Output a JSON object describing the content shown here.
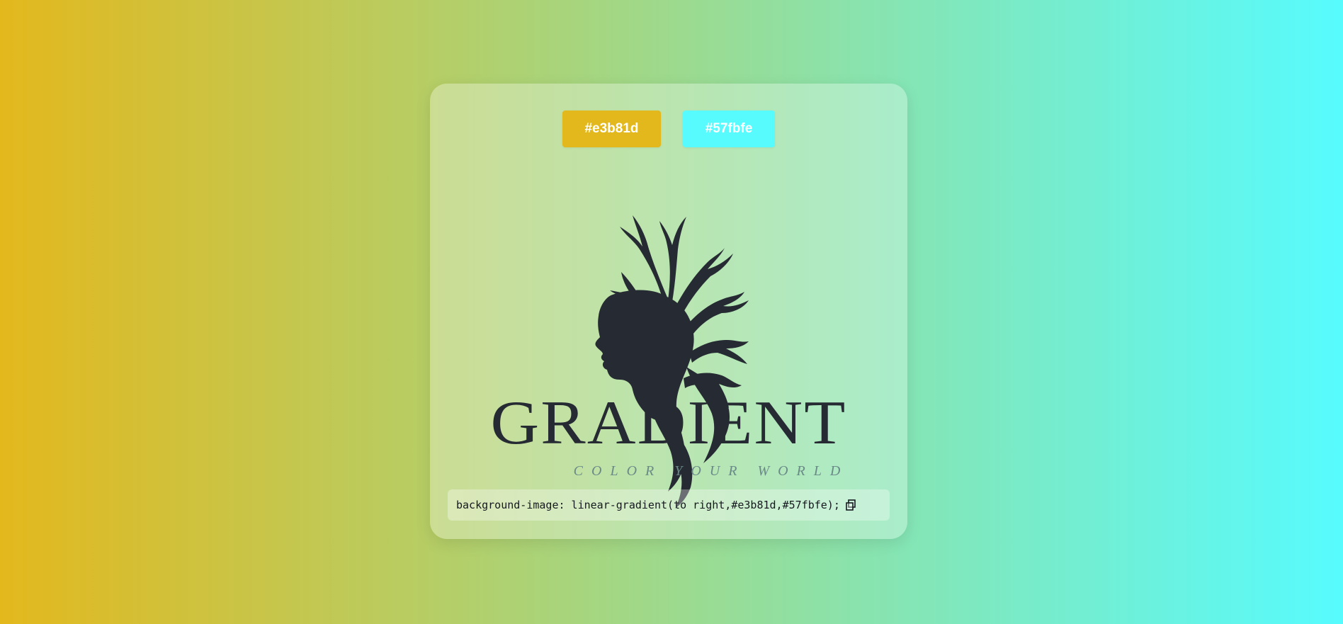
{
  "colors": {
    "start": "#e3b81d",
    "end": "#57fbfe",
    "logo_ink": "#262b33"
  },
  "swatches": [
    {
      "label": "#e3b81d",
      "color": "#e3b81d"
    },
    {
      "label": "#57fbfe",
      "color": "#57fbfe"
    }
  ],
  "logo": {
    "title": "GRADIENT",
    "tagline": "COLOR YOUR WORLD",
    "icon": "woman-with-branches-logo"
  },
  "css_snippet": "background-image: linear-gradient(to right,#e3b81d,#57fbfe);",
  "copy_icon": "copy-icon"
}
